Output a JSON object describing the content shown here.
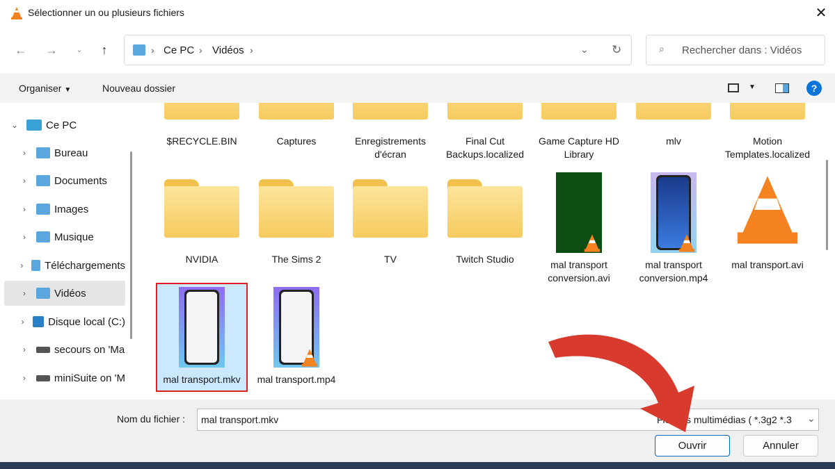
{
  "window": {
    "title": "Sélectionner un ou plusieurs fichiers",
    "close_icon": "close-icon"
  },
  "address": {
    "crumbs": [
      "Ce PC",
      "Vidéos"
    ],
    "search_placeholder": "Rechercher dans : Vidéos"
  },
  "toolbar": {
    "organize": "Organiser",
    "new_folder": "Nouveau dossier"
  },
  "sidebar": {
    "items": [
      {
        "label": "Ce PC",
        "expanded": true
      },
      {
        "label": "Bureau"
      },
      {
        "label": "Documents"
      },
      {
        "label": "Images"
      },
      {
        "label": "Musique"
      },
      {
        "label": "Téléchargements"
      },
      {
        "label": "Vidéos",
        "selected": true
      },
      {
        "label": "Disque local (C:)"
      },
      {
        "label": "secours on 'Ma"
      },
      {
        "label": "miniSuite on 'M"
      }
    ]
  },
  "files": {
    "row1": [
      "$RECYCLE.BIN",
      "Captures",
      "Enregistrements d'écran",
      "Final Cut Backups.localized",
      "Game Capture HD Library",
      "mlv",
      "Motion Templates.localized"
    ],
    "row2": [
      "NVIDIA",
      "The Sims 2",
      "TV",
      "Twitch Studio",
      "mal transport conversion.avi",
      "mal transport conversion.mp4",
      "mal transport.avi"
    ],
    "row3": [
      "mal transport.mkv",
      "mal transport.mp4"
    ],
    "selected": "mal transport.mkv"
  },
  "footer": {
    "filename_label": "Nom du fichier :",
    "filename_value": "mal transport.mkv",
    "filter": "Fichiers multimédias ( *.3g2 *.3",
    "open": "Ouvrir",
    "cancel": "Annuler"
  },
  "colors": {
    "accent": "#0067c0",
    "selection": "#cce8ff",
    "highlight_box": "#e02020",
    "arrow": "#d93a2e"
  }
}
